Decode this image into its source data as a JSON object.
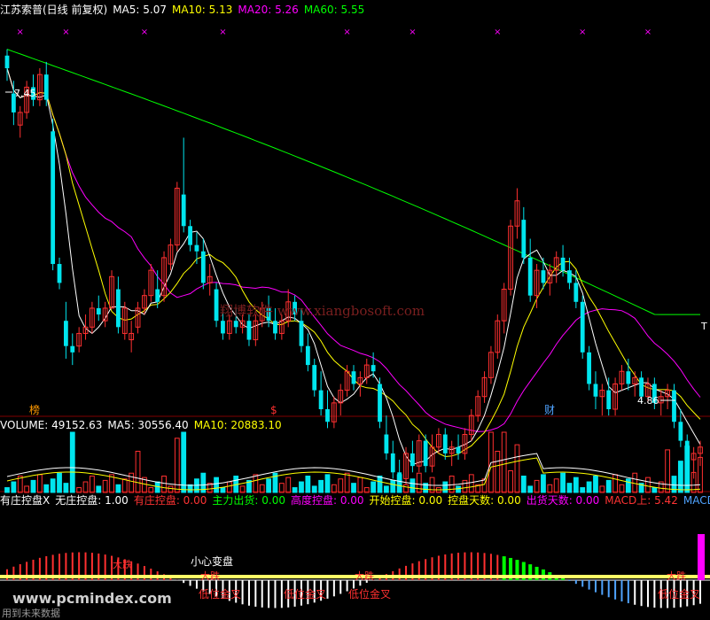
{
  "main_header": {
    "title": "江苏索普(日线 前复权)",
    "items": [
      {
        "label": "MA5: 5.07",
        "color": "#ffffff"
      },
      {
        "label": "MA10: 5.13",
        "color": "#ffff00"
      },
      {
        "label": "MA20: 5.26",
        "color": "#ff00ff"
      },
      {
        "label": "MA60: 5.55",
        "color": "#00ff00"
      }
    ]
  },
  "volume_header": {
    "items": [
      {
        "label": "VOLUME: 49152.63",
        "color": "#ffffff"
      },
      {
        "label": "MA5: 30556.40",
        "color": "#ffffff"
      },
      {
        "label": "MA10: 20883.10",
        "color": "#ffff00"
      }
    ]
  },
  "indicator_header": {
    "items": [
      {
        "label": "有庄控盘X",
        "color": "#ffffff"
      },
      {
        "label": "无庄控盘: 1.00",
        "color": "#ffffff"
      },
      {
        "label": "有庄控盘: 0.00",
        "color": "#ff3333"
      },
      {
        "label": "主力出货: 0.00",
        "color": "#00ff00"
      },
      {
        "label": "高度控盘: 0.00",
        "color": "#ff00ff"
      },
      {
        "label": "开始控盘: 0.00",
        "color": "#ffff00"
      },
      {
        "label": "控盘天数: 0.00",
        "color": "#ffff00"
      },
      {
        "label": "出货天数: 0.00",
        "color": "#ff00ff"
      },
      {
        "label": "MACD上: 5.42",
        "color": "#ff3333"
      },
      {
        "label": "MACD下",
        "color": "#4fa3ff"
      }
    ]
  },
  "price_labels": {
    "high": "7.45",
    "low": "4.86"
  },
  "markers": {
    "bang": "榜",
    "dollar": "$",
    "cai": "财",
    "top_marker": "×"
  },
  "indicator_labels": {
    "caution": "小心变盘",
    "low_cross": "低位金叉",
    "big_fall": "大跌"
  },
  "watermark": "翔博软件 www.xiangbosoft.com",
  "site_watermark": "www.pcmindex.com",
  "bottom_note": "用到未来数据",
  "colors": {
    "up": "#ff3030",
    "down": "#00e5ee",
    "ma5": "#ffffff",
    "ma10": "#ffff00",
    "ma20": "#ff00ff",
    "ma60": "#00ff00"
  },
  "chart_data": {
    "type": "candlestick",
    "ylim": [
      4.6,
      7.7
    ],
    "candles": [
      [
        7.4,
        7.45,
        7.2,
        7.3
      ],
      [
        7.1,
        7.2,
        6.85,
        6.95
      ],
      [
        6.85,
        7.0,
        6.75,
        6.95
      ],
      [
        6.95,
        7.2,
        6.9,
        7.15
      ],
      [
        7.15,
        7.25,
        7.0,
        7.05
      ],
      [
        7.05,
        7.3,
        7.0,
        7.25
      ],
      [
        7.25,
        7.35,
        7.0,
        7.05
      ],
      [
        6.8,
        6.9,
        5.7,
        5.75
      ],
      [
        5.75,
        5.8,
        5.55,
        5.6
      ],
      [
        5.3,
        5.45,
        5.0,
        5.1
      ],
      [
        5.1,
        5.2,
        4.95,
        5.05
      ],
      [
        5.1,
        5.25,
        5.05,
        5.2
      ],
      [
        5.2,
        5.35,
        5.15,
        5.25
      ],
      [
        5.25,
        5.45,
        5.2,
        5.4
      ],
      [
        5.4,
        5.5,
        5.3,
        5.35
      ],
      [
        5.3,
        5.45,
        5.25,
        5.4
      ],
      [
        5.4,
        5.7,
        5.4,
        5.65
      ],
      [
        5.55,
        5.65,
        5.2,
        5.25
      ],
      [
        5.2,
        5.45,
        5.15,
        5.4
      ],
      [
        5.15,
        5.3,
        5.05,
        5.2
      ],
      [
        5.25,
        5.45,
        5.2,
        5.4
      ],
      [
        5.4,
        5.55,
        5.35,
        5.5
      ],
      [
        5.5,
        5.75,
        5.45,
        5.7
      ],
      [
        5.55,
        5.7,
        5.4,
        5.45
      ],
      [
        5.5,
        5.85,
        5.45,
        5.8
      ],
      [
        5.75,
        5.95,
        5.7,
        5.9
      ],
      [
        5.9,
        6.4,
        5.85,
        6.35
      ],
      [
        6.3,
        6.75,
        6.0,
        6.05
      ],
      [
        6.05,
        6.1,
        5.85,
        5.9
      ],
      [
        5.9,
        6.0,
        5.75,
        5.85
      ],
      [
        5.85,
        5.95,
        5.55,
        5.6
      ],
      [
        5.6,
        5.75,
        5.5,
        5.65
      ],
      [
        5.55,
        5.6,
        5.25,
        5.3
      ],
      [
        5.3,
        5.4,
        5.15,
        5.2
      ],
      [
        5.2,
        5.35,
        5.15,
        5.3
      ],
      [
        5.3,
        5.4,
        5.2,
        5.25
      ],
      [
        5.25,
        5.35,
        5.2,
        5.3
      ],
      [
        5.3,
        5.35,
        5.1,
        5.15
      ],
      [
        5.15,
        5.35,
        5.1,
        5.3
      ],
      [
        5.3,
        5.45,
        5.25,
        5.4
      ],
      [
        5.4,
        5.5,
        5.25,
        5.3
      ],
      [
        5.3,
        5.4,
        5.15,
        5.2
      ],
      [
        5.2,
        5.35,
        5.15,
        5.3
      ],
      [
        5.3,
        5.55,
        5.25,
        5.45
      ],
      [
        5.45,
        5.5,
        5.3,
        5.35
      ],
      [
        5.3,
        5.4,
        5.05,
        5.1
      ],
      [
        5.1,
        5.2,
        4.9,
        4.95
      ],
      [
        4.95,
        5.0,
        4.7,
        4.75
      ],
      [
        4.75,
        4.9,
        4.55,
        4.6
      ],
      [
        4.6,
        4.75,
        4.45,
        4.5
      ],
      [
        4.5,
        4.7,
        4.45,
        4.65
      ],
      [
        4.65,
        4.8,
        4.55,
        4.75
      ],
      [
        4.75,
        4.95,
        4.7,
        4.9
      ],
      [
        4.9,
        4.95,
        4.75,
        4.8
      ],
      [
        4.8,
        4.9,
        4.7,
        4.85
      ],
      [
        4.85,
        5.0,
        4.8,
        4.95
      ],
      [
        4.95,
        5.05,
        4.85,
        4.9
      ],
      [
        4.8,
        4.85,
        4.45,
        4.5
      ],
      [
        4.4,
        4.55,
        4.2,
        4.25
      ],
      [
        4.25,
        4.35,
        4.05,
        4.1
      ],
      [
        4.1,
        4.2,
        4.0,
        4.05
      ],
      [
        4.05,
        4.3,
        4.0,
        4.25
      ],
      [
        4.25,
        4.35,
        4.1,
        4.15
      ],
      [
        4.15,
        4.4,
        4.1,
        4.35
      ],
      [
        4.35,
        4.4,
        4.1,
        4.15
      ],
      [
        4.15,
        4.4,
        4.1,
        4.3
      ],
      [
        4.3,
        4.45,
        4.25,
        4.4
      ],
      [
        4.4,
        4.45,
        4.2,
        4.25
      ],
      [
        4.25,
        4.35,
        4.15,
        4.3
      ],
      [
        4.3,
        4.4,
        4.2,
        4.25
      ],
      [
        4.25,
        4.45,
        4.2,
        4.4
      ],
      [
        4.4,
        4.6,
        4.35,
        4.55
      ],
      [
        4.55,
        4.75,
        4.5,
        4.7
      ],
      [
        4.7,
        4.9,
        4.65,
        4.85
      ],
      [
        4.85,
        5.1,
        4.8,
        5.05
      ],
      [
        5.05,
        5.35,
        5.0,
        5.3
      ],
      [
        5.3,
        5.6,
        5.2,
        5.55
      ],
      [
        5.55,
        6.1,
        5.5,
        6.05
      ],
      [
        6.05,
        6.35,
        5.95,
        6.25
      ],
      [
        6.1,
        6.2,
        5.75,
        5.8
      ],
      [
        5.8,
        5.95,
        5.45,
        5.5
      ],
      [
        5.5,
        5.75,
        5.4,
        5.7
      ],
      [
        5.7,
        5.8,
        5.55,
        5.6
      ],
      [
        5.6,
        5.75,
        5.5,
        5.7
      ],
      [
        5.7,
        5.85,
        5.6,
        5.8
      ],
      [
        5.8,
        5.9,
        5.65,
        5.7
      ],
      [
        5.7,
        5.8,
        5.55,
        5.6
      ],
      [
        5.6,
        5.7,
        5.4,
        5.45
      ],
      [
        5.45,
        5.5,
        5.0,
        5.05
      ],
      [
        5.05,
        5.1,
        4.75,
        4.8
      ],
      [
        4.8,
        4.9,
        4.6,
        4.7
      ],
      [
        4.7,
        4.8,
        4.55,
        4.75
      ],
      [
        4.75,
        4.85,
        4.55,
        4.6
      ],
      [
        4.6,
        4.85,
        4.55,
        4.8
      ],
      [
        4.8,
        4.95,
        4.75,
        4.9
      ],
      [
        4.9,
        5.0,
        4.75,
        4.8
      ],
      [
        4.8,
        4.9,
        4.7,
        4.85
      ],
      [
        4.85,
        4.9,
        4.65,
        4.7
      ],
      [
        4.7,
        4.85,
        4.65,
        4.8
      ],
      [
        4.8,
        4.85,
        4.6,
        4.65
      ],
      [
        4.65,
        4.75,
        4.55,
        4.7
      ],
      [
        4.7,
        4.8,
        4.6,
        4.75
      ],
      [
        4.75,
        4.8,
        4.45,
        4.5
      ],
      [
        4.5,
        4.6,
        4.3,
        4.35
      ],
      [
        4.35,
        4.4,
        4.15,
        4.2
      ],
      [
        4.2,
        4.3,
        4.05,
        4.25
      ],
      [
        4.25,
        4.35,
        4.15,
        4.3
      ]
    ],
    "volume": {
      "ylim": [
        0,
        120000
      ]
    },
    "macd": {
      "ylim": [
        -0.6,
        0.6
      ]
    }
  }
}
